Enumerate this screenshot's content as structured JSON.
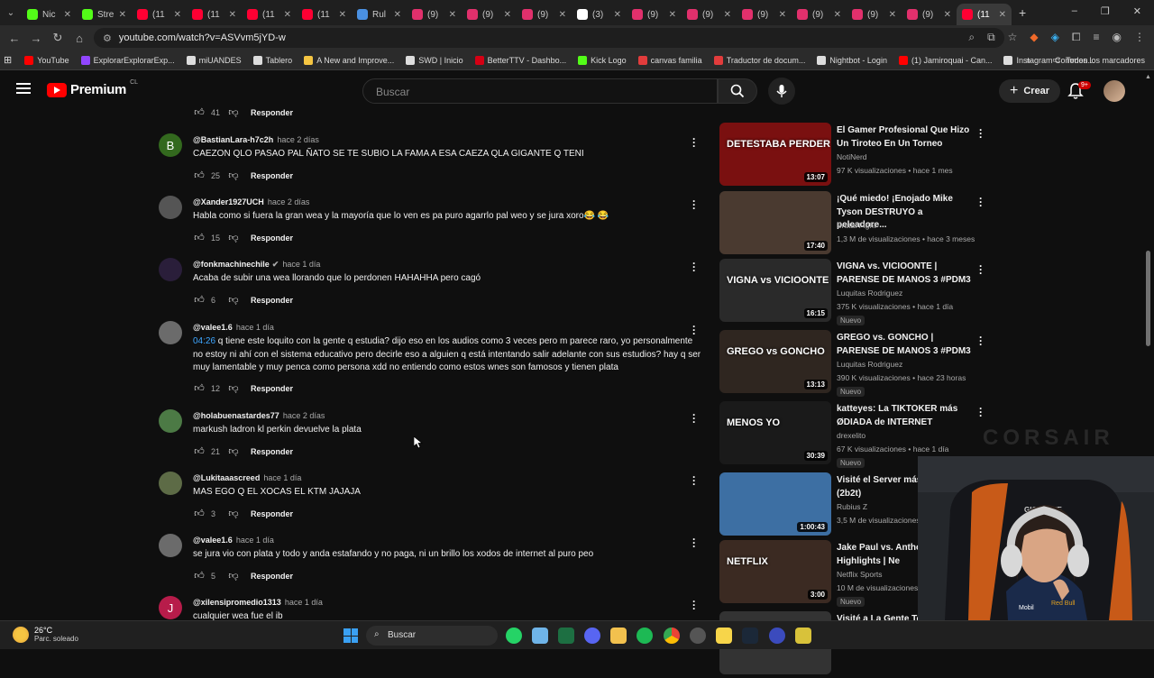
{
  "browser": {
    "tabs": [
      {
        "label": "Nic",
        "color": "#53fc18"
      },
      {
        "label": "Stre",
        "color": "#53fc18"
      },
      {
        "label": "(11",
        "color": "#ff0033"
      },
      {
        "label": "(11",
        "color": "#ff0033"
      },
      {
        "label": "(11",
        "color": "#ff0033"
      },
      {
        "label": "(11",
        "color": "#ff0033"
      },
      {
        "label": "Rul",
        "color": "#4a90e2"
      },
      {
        "label": "(9)",
        "color": "#e1306c"
      },
      {
        "label": "(9)",
        "color": "#e1306c"
      },
      {
        "label": "(9)",
        "color": "#e1306c"
      },
      {
        "label": "(3)",
        "color": "#ffffff"
      },
      {
        "label": "(9)",
        "color": "#e1306c"
      },
      {
        "label": "(9)",
        "color": "#e1306c"
      },
      {
        "label": "(9)",
        "color": "#e1306c"
      },
      {
        "label": "(9)",
        "color": "#e1306c"
      },
      {
        "label": "(9)",
        "color": "#e1306c"
      },
      {
        "label": "(9)",
        "color": "#e1306c"
      },
      {
        "label": "(11",
        "color": "#ff0033"
      }
    ],
    "url": "youtube.com/watch?v=ASVvm5jYD-w",
    "bookmarks": [
      {
        "label": "YouTube",
        "color": "#ff0000"
      },
      {
        "label": "ExplorarExplorarExp...",
        "color": "#9146ff"
      },
      {
        "label": "miUANDES",
        "color": "#dddddd"
      },
      {
        "label": "Tablero",
        "color": "#dddddd"
      },
      {
        "label": "A New and Improve...",
        "color": "#f5c542"
      },
      {
        "label": "SWD | Inicio",
        "color": "#dddddd"
      },
      {
        "label": "BetterTTV - Dashbo...",
        "color": "#d50014"
      },
      {
        "label": "Kick Logo",
        "color": "#53fc18"
      },
      {
        "label": "canvas familia",
        "color": "#e23c3c"
      },
      {
        "label": "Traductor de docum...",
        "color": "#e23c3c"
      },
      {
        "label": "Nightbot - Login",
        "color": "#dddddd"
      },
      {
        "label": "(1) Jamiroquai - Can...",
        "color": "#ff0000"
      },
      {
        "label": "Instagram Commen...",
        "color": "#dddddd"
      }
    ],
    "bookmarks_all": "Todos los marcadores"
  },
  "header": {
    "logo": "Premium",
    "country": "CL",
    "search_placeholder": "Buscar",
    "create_label": "Crear",
    "notif_count": "9+"
  },
  "comments": [
    {
      "user": "",
      "time": "",
      "text": "",
      "likes": "41",
      "reply": "Responder",
      "avatar": "",
      "avatar_color": ""
    },
    {
      "user": "@BastianLara-h7c2h",
      "time": "hace 2 días",
      "text": "CAEZON QLO PASAO PAL ÑATO SE TE SUBIO LA FAMA A ESA CAEZA QLA GIGANTE Q TENI",
      "likes": "25",
      "reply": "Responder",
      "avatar": "B",
      "avatar_color": "#33691e"
    },
    {
      "user": "@Xander1927UCH",
      "time": "hace 2 días",
      "text": "Habla como si fuera la gran wea y la mayoría que lo ven es pa puro agarrlo pal weo y se jura xoro😂 😂",
      "likes": "15",
      "reply": "Responder",
      "avatar": "",
      "avatar_color": "#555555"
    },
    {
      "user": "@fonkmachinechile",
      "time": "hace 1 día",
      "text": "Acaba de subir una wea llorando que lo perdonen HAHAHHA pero cagó",
      "likes": "6",
      "reply": "Responder",
      "avatar": "",
      "avatar_color": "#2a1e3a"
    },
    {
      "user": "@valee1.6",
      "time": "hace 1 día",
      "ts": "04:26",
      "text": " q tiene este loquito con la gente q estudia? dijo eso en los audios como 3 veces pero m parece raro, yo personalmente no estoy ni ahí con el sistema educativo pero decirle eso a alguien q está intentando salir adelante con sus estudios? hay q ser muy lamentable y muy penca como persona xdd no entiendo como estos wnes son famosos y tienen plata",
      "likes": "12",
      "reply": "Responder",
      "avatar": "",
      "avatar_color": "#6b6b6b"
    },
    {
      "user": "@holabuenastardes77",
      "time": "hace 2 días",
      "text": "markush ladron kl perkin devuelve la plata",
      "likes": "21",
      "reply": "Responder",
      "avatar": "",
      "avatar_color": "#4c7a45"
    },
    {
      "user": "@Lukitaaascreed",
      "time": "hace 1 día",
      "text": "MAS EGO Q EL XOCAS EL KTM JAJAJA",
      "likes": "3",
      "reply": "Responder",
      "avatar": "",
      "avatar_color": "#5d6b46"
    },
    {
      "user": "@valee1.6",
      "time": "hace 1 día",
      "text": "se jura vio con plata y todo y anda estafando y no paga, ni un brillo los xodos de internet al puro peo",
      "likes": "5",
      "reply": "Responder",
      "avatar": "",
      "avatar_color": "#6b6b6b"
    },
    {
      "user": "@xilensipromedio1313",
      "time": "hace 1 día",
      "text": "cualquier wea fue el ib",
      "likes": "",
      "reply": "",
      "avatar": "J",
      "avatar_color": "#b71c4a"
    }
  ],
  "videos": [
    {
      "title": "El Gamer Profesional Que Hizo Un Tiroteo En Un Torneo",
      "channel": "NotiNerd",
      "stats": "97 K visualizaciones • hace 1 mes",
      "duration": "13:07",
      "thumb_text": "DETESTABA PERDER",
      "nuevo": "",
      "bg": "#7a1010"
    },
    {
      "title": "¡Qué miedo! ¡Enojado Mike Tyson DESTRUYO a peleadore...",
      "channel": "Brutal Fight",
      "stats": "1,3 M de visualizaciones • hace 3 meses",
      "duration": "17:40",
      "thumb_text": "",
      "nuevo": "",
      "bg": "#4a3a30"
    },
    {
      "title": "VIGNA vs. VICIOONTE | PARENSE DE MANOS 3 #PDM3",
      "channel": "Luquitas Rodriguez",
      "stats": "375 K visualizaciones • hace 1 día",
      "duration": "16:15",
      "thumb_text": "VIGNA vs VICIOONTE",
      "nuevo": "Nuevo",
      "bg": "#2a2a2a"
    },
    {
      "title": "GREGO vs. GONCHO | PARENSE DE MANOS 3 #PDM3",
      "channel": "Luquitas Rodriguez",
      "stats": "390 K visualizaciones • hace 23 horas",
      "duration": "13:13",
      "thumb_text": "GREGO vs GONCHO",
      "nuevo": "Nuevo",
      "bg": "#2f2620"
    },
    {
      "title": "katteyes: La TIKTOKER más ØDIADA de INTERNET",
      "channel": "drexelito",
      "stats": "67 K visualizaciones • hace 1 día",
      "duration": "30:39",
      "thumb_text": "MENOS YO",
      "nuevo": "Nuevo",
      "bg": "#1a1a1a"
    },
    {
      "title": "Visité el Server más Minecraft (2b2t)",
      "channel": "Rubius Z",
      "stats": "3,5 M de visualizaciones",
      "duration": "1:00:43",
      "thumb_text": "",
      "nuevo": "",
      "bg": "#3d6fa3"
    },
    {
      "title": "Jake Paul vs. Antho FULL Highlights | Ne",
      "channel": "Netflix Sports",
      "stats": "10 M de visualizaciones",
      "duration": "3:00",
      "thumb_text": "NETFLIX",
      "nuevo": "Nuevo",
      "bg": "#3b2a22"
    },
    {
      "title": "Visité a La Gente To",
      "channel": "",
      "stats": "",
      "duration": "",
      "thumb_text": "",
      "nuevo": "",
      "bg": "#333333"
    }
  ],
  "overlay": {
    "brand": "CORSAIR"
  },
  "taskbar": {
    "temp": "26°C",
    "weather": "Parc. soleado",
    "search": "Buscar"
  }
}
